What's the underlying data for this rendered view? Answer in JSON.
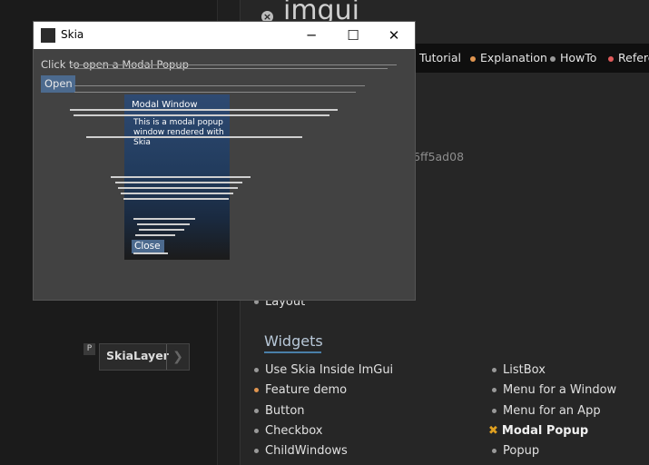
{
  "background_panel": {
    "title": "imgui",
    "close_icon": "close-circle-icon"
  },
  "navbar": {
    "items": [
      {
        "label": "Tutorial",
        "dot_color": ""
      },
      {
        "label": "Explanation",
        "dot_color": "#e09550"
      },
      {
        "label": "HowTo",
        "dot_color": "#999999"
      },
      {
        "label": "Refere",
        "dot_color": "#e05a5a"
      }
    ]
  },
  "main": {
    "hash_text": "6ff5ad08",
    "layout_item": "Layout",
    "widgets_heading": "Widgets",
    "widgets_left": [
      "Use Skia Inside ImGui",
      "Feature demo",
      "Button",
      "Checkbox",
      "ChildWindows"
    ],
    "widgets_right": [
      "ListBox",
      "Menu for a Window",
      "Menu for an App",
      "Modal Popup",
      "Popup"
    ]
  },
  "left_panel": {
    "badge": "P",
    "node_label": "SkiaLayer",
    "node_arrow": "❯"
  },
  "skia_window": {
    "title": "Skia",
    "minimize": "─",
    "maximize": "☐",
    "close": "✕",
    "link_text": "Click to open a Modal Popup",
    "open_button": "Open",
    "modal": {
      "title": "Modal Window",
      "text": "This is a modal popup window rendered with Skia",
      "close_button": "Close"
    }
  },
  "colors": {
    "accent_blue": "#4c6a8e",
    "widgets_underline": "#4a7fa8",
    "x_mark": "#e0a020"
  }
}
